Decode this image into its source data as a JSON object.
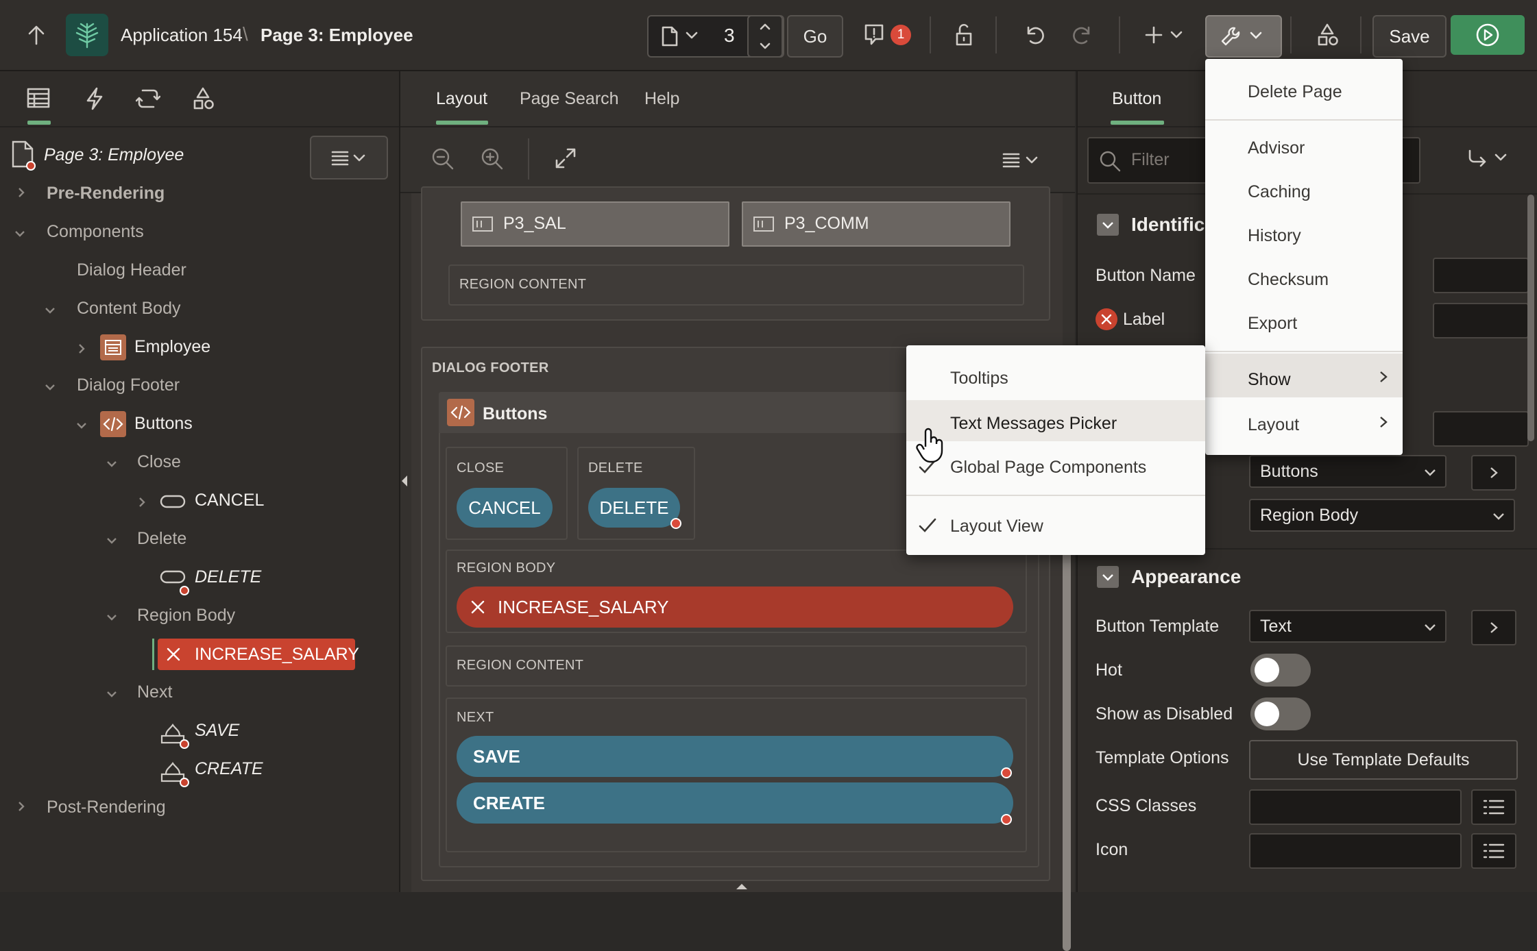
{
  "header": {
    "app_name": "Application 154",
    "separator": "\\",
    "page_name": "Page 3: Employee",
    "page_number": "3",
    "go_label": "Go",
    "error_count": "1",
    "save_label": "Save"
  },
  "left_tabs": [
    "rendering-tab",
    "dynamic-actions-tab",
    "processing-tab",
    "shared-components-tab"
  ],
  "tree": {
    "root": "Page 3: Employee",
    "pre_rendering": "Pre-Rendering",
    "components": "Components",
    "dialog_header": "Dialog Header",
    "content_body": "Content Body",
    "employee": "Employee",
    "dialog_footer": "Dialog Footer",
    "buttons": "Buttons",
    "close": "Close",
    "cancel": "CANCEL",
    "delete_group": "Delete",
    "delete": "DELETE",
    "region_body": "Region Body",
    "increase_salary": "INCREASE_SALARY",
    "next": "Next",
    "save": "SAVE",
    "create": "CREATE",
    "post_rendering": "Post-Rendering"
  },
  "center": {
    "tabs": [
      "Layout",
      "Page Search",
      "Help"
    ],
    "active_tab": "Layout",
    "field_sal": "P3_SAL",
    "field_comm": "P3_COMM",
    "region_content_1": "REGION CONTENT",
    "dialog_footer": "DIALOG FOOTER",
    "buttons_region": "Buttons",
    "close_label": "CLOSE",
    "cancel_btn": "CANCEL",
    "delete_label": "DELETE",
    "delete_btn": "DELETE",
    "region_body": "REGION BODY",
    "increase_salary": "INCREASE_SALARY",
    "region_content_2": "REGION CONTENT",
    "next_label": "NEXT",
    "save_btn": "SAVE",
    "create_btn": "CREATE"
  },
  "right": {
    "tab_button": "Button",
    "filter_placeholder": "Filter",
    "identification_heading": "Identifica",
    "button_name_label": "Button Name",
    "label_label": "Label",
    "region_select": "Buttons",
    "position_select": "Region Body",
    "appearance_heading": "Appearance",
    "button_template_label": "Button Template",
    "button_template_value": "Text",
    "hot_label": "Hot",
    "show_disabled_label": "Show as Disabled",
    "template_options_label": "Template Options",
    "template_defaults_btn": "Use Template Defaults",
    "css_classes_label": "CSS Classes",
    "icon_label": "Icon"
  },
  "utilities_menu": {
    "items": [
      "Delete Page",
      "Advisor",
      "Caching",
      "History",
      "Checksum",
      "Export",
      "Show",
      "Layout"
    ]
  },
  "show_submenu": {
    "items": [
      {
        "label": "Tooltips",
        "checked": false
      },
      {
        "label": "Text Messages Picker",
        "checked": false
      },
      {
        "label": "Global Page Components",
        "checked": true
      },
      {
        "label": "Layout View",
        "checked": true
      }
    ]
  },
  "colors": {
    "accent_green": "#3f8f5b",
    "teal_button": "#3d7286",
    "danger_red": "#b5402f",
    "tree_selected": "#c9432f"
  }
}
